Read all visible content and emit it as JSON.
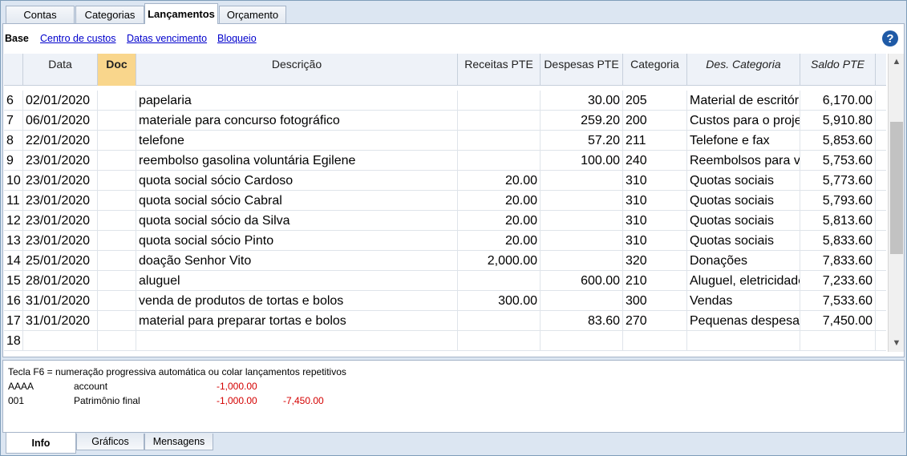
{
  "top_tabs": [
    {
      "label": "Contas"
    },
    {
      "label": "Categorias"
    },
    {
      "label": "Lançamentos",
      "active": true
    },
    {
      "label": "Orçamento"
    }
  ],
  "views": {
    "current": "Base",
    "links": [
      "Centro de custos",
      "Datas vencimento",
      "Bloqueio"
    ]
  },
  "help_label": "?",
  "columns": [
    "Data",
    "Doc",
    "Descrição",
    "Receitas PTE",
    "Despesas PTE",
    "Categoria",
    "Des. Categoria",
    "Saldo PTE"
  ],
  "rows": [
    {
      "n": "6",
      "date": "02/01/2020",
      "doc": "",
      "desc": "papelaria",
      "income": "",
      "expense": "30.00",
      "cat": "205",
      "catdesc": "Material de escritório",
      "balance": "6,170.00"
    },
    {
      "n": "7",
      "date": "06/01/2020",
      "doc": "",
      "desc": "materiale para concurso fotográfico",
      "income": "",
      "expense": "259.20",
      "cat": "200",
      "catdesc": "Custos para o projeto",
      "balance": "5,910.80"
    },
    {
      "n": "8",
      "date": "22/01/2020",
      "doc": "",
      "desc": "telefone",
      "income": "",
      "expense": "57.20",
      "cat": "211",
      "catdesc": "Telefone e fax",
      "balance": "5,853.60"
    },
    {
      "n": "9",
      "date": "23/01/2020",
      "doc": "",
      "desc": "reembolso gasolina voluntária Egilene",
      "income": "",
      "expense": "100.00",
      "cat": "240",
      "catdesc": "Reembolsos para voluntários",
      "balance": "5,753.60"
    },
    {
      "n": "10",
      "date": "23/01/2020",
      "doc": "",
      "desc": "quota social sócio Cardoso",
      "income": "20.00",
      "expense": "",
      "cat": "310",
      "catdesc": "Quotas sociais",
      "balance": "5,773.60"
    },
    {
      "n": "11",
      "date": "23/01/2020",
      "doc": "",
      "desc": "quota social sócio Cabral",
      "income": "20.00",
      "expense": "",
      "cat": "310",
      "catdesc": "Quotas sociais",
      "balance": "5,793.60"
    },
    {
      "n": "12",
      "date": "23/01/2020",
      "doc": "",
      "desc": "quota social sócio da Silva",
      "income": "20.00",
      "expense": "",
      "cat": "310",
      "catdesc": "Quotas sociais",
      "balance": "5,813.60"
    },
    {
      "n": "13",
      "date": "23/01/2020",
      "doc": "",
      "desc": "quota social sócio Pinto",
      "income": "20.00",
      "expense": "",
      "cat": "310",
      "catdesc": "Quotas sociais",
      "balance": "5,833.60"
    },
    {
      "n": "14",
      "date": "25/01/2020",
      "doc": "",
      "desc": "doação Senhor Vito",
      "income": "2,000.00",
      "expense": "",
      "cat": "320",
      "catdesc": "Donações",
      "balance": "7,833.60"
    },
    {
      "n": "15",
      "date": "28/01/2020",
      "doc": "",
      "desc": "aluguel",
      "income": "",
      "expense": "600.00",
      "cat": "210",
      "catdesc": "Aluguel, eletricidade",
      "balance": "7,233.60"
    },
    {
      "n": "16",
      "date": "31/01/2020",
      "doc": "",
      "desc": "venda de produtos de tortas e bolos",
      "income": "300.00",
      "expense": "",
      "cat": "300",
      "catdesc": "Vendas",
      "balance": "7,533.60"
    },
    {
      "n": "17",
      "date": "31/01/2020",
      "doc": "",
      "desc": "material para preparar tortas e bolos",
      "income": "",
      "expense": "83.60",
      "cat": "270",
      "catdesc": "Pequenas despesas",
      "balance": "7,450.00"
    },
    {
      "n": "18",
      "date": "",
      "doc": "",
      "desc": "",
      "income": "",
      "expense": "",
      "cat": "",
      "catdesc": "",
      "balance": ""
    }
  ],
  "info": {
    "hint": "Tecla F6 = numeração progressiva automática ou colar lançamentos repetitivos",
    "lines": [
      {
        "code": "AAAA",
        "label": "account",
        "v1": "-1,000.00",
        "v2": ""
      },
      {
        "code": "001",
        "label": "Patrimônio final",
        "v1": "-1,000.00",
        "v2": "-7,450.00"
      }
    ]
  },
  "bottom_tabs": [
    {
      "label": "Info",
      "active": true
    },
    {
      "label": "Gráficos"
    },
    {
      "label": "Mensagens"
    }
  ],
  "colors": {
    "doc_header": "#f9d68c",
    "negative": "#d40000",
    "link": "#0000cc"
  }
}
